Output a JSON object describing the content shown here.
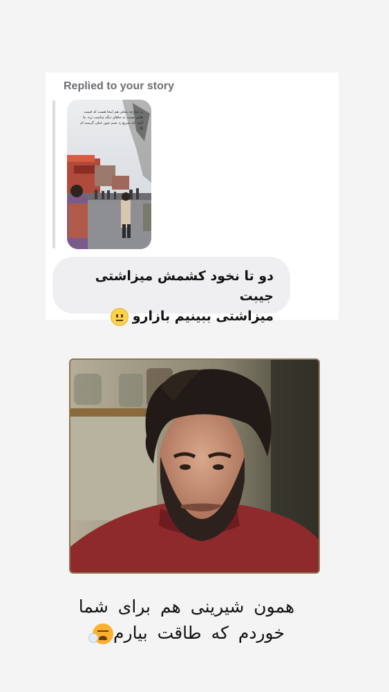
{
  "reply_card": {
    "label": "Replied to your story",
    "story_caption": "یه بازارچه محلی هم اینجا هست که قیمت هاش نسبت به جاهای دیگه مناسب تره. ما البته باید سریع رد شیم چون خیلی گرسنه ام 😋",
    "message_line1": "دو تا نخود کشمش میزاشتی جیبت",
    "message_line2": "میزاشتی ببینیم بازارو",
    "message_emoji": "neutral-face-icon"
  },
  "caption": {
    "line1": "همون شیرینی هم برای شما",
    "line2": "خوردم که طاقت بیارم",
    "emoji": "tired-face-icon"
  },
  "colors": {
    "background": "#f4f4f5",
    "card": "#ffffff",
    "bubble": "#efeff2",
    "label": "#6e6e73"
  }
}
